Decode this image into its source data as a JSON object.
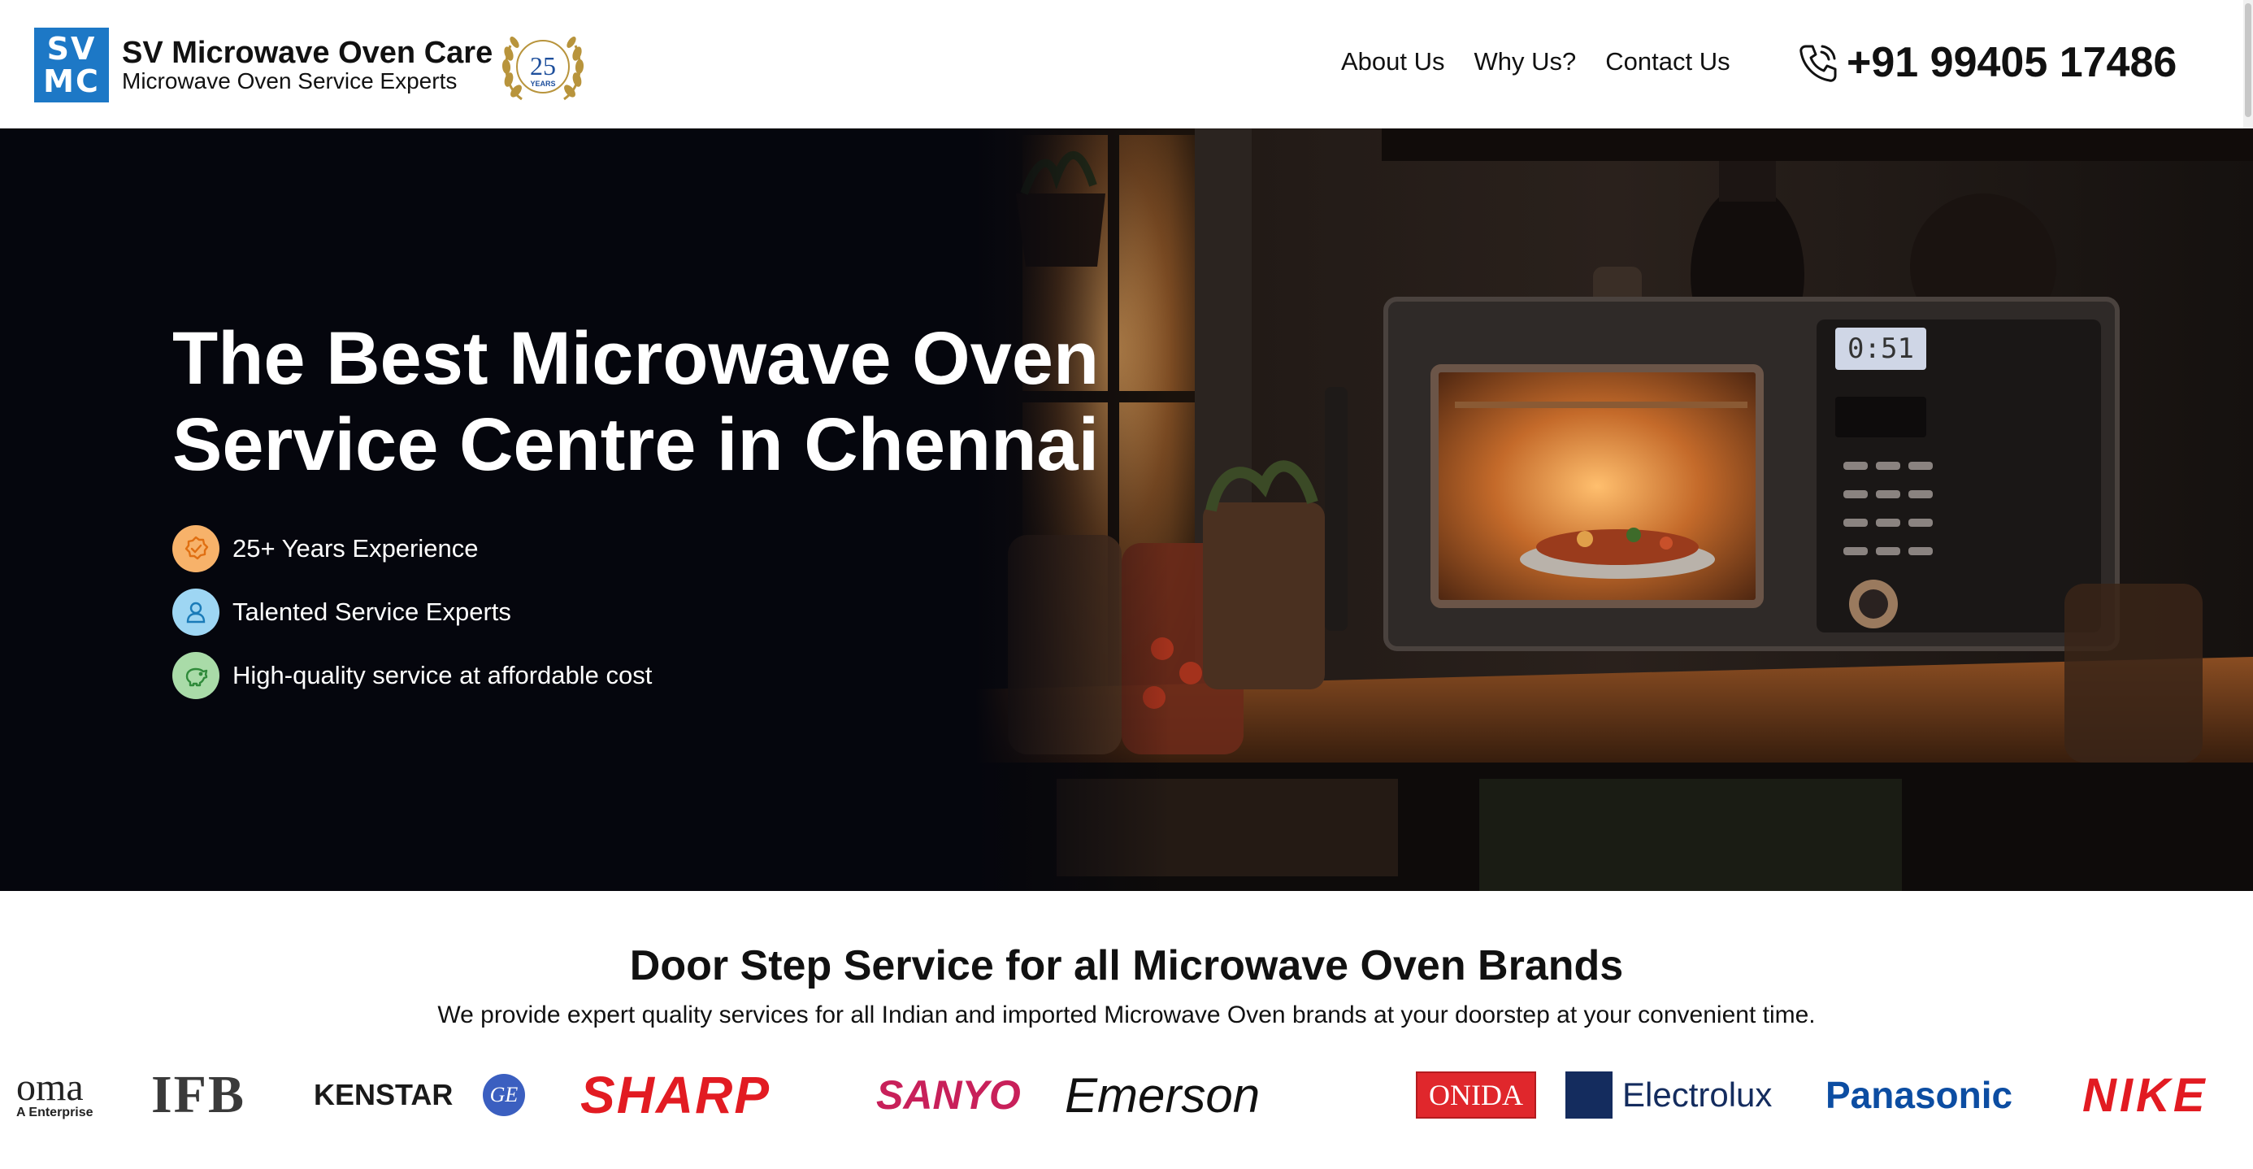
{
  "header": {
    "logo_letters_top": "SV",
    "logo_letters_bottom": "MC",
    "brand_name": "SV Microwave Oven Care",
    "brand_tagline": "Microwave Oven Service Experts",
    "badge_number": "25",
    "badge_text": "YEARS"
  },
  "nav": {
    "items": [
      {
        "label": "About Us"
      },
      {
        "label": "Why Us?"
      },
      {
        "label": "Contact Us"
      }
    ]
  },
  "phone": {
    "icon": "phone-call-icon",
    "number": "+91 99405 17486"
  },
  "hero": {
    "title_line1": "The Best Microwave Oven",
    "title_line2": "Service Centre in Chennai",
    "features": [
      {
        "label": "25+ Years Experience",
        "icon": "badge-check-icon",
        "color": "#f7b26a"
      },
      {
        "label": "Talented Service Experts",
        "icon": "user-icon",
        "color": "#9ed6f3"
      },
      {
        "label": "High-quality service at affordable cost",
        "icon": "piggy-bank-icon",
        "color": "#a9dba8"
      }
    ],
    "oven_display": "0:51"
  },
  "brands": {
    "heading": "Door Step Service for all Microwave Oven Brands",
    "subheading": "We provide expert quality services for all Indian and imported Microwave Oven brands at your doorstep at your convenient time.",
    "logos": [
      {
        "name": "oma",
        "sub": "A Enterprise"
      },
      {
        "name": "IFB"
      },
      {
        "name": "KENSTAR"
      },
      {
        "name": "GE"
      },
      {
        "name": "SHARP"
      },
      {
        "name": "SANYO"
      },
      {
        "name": "Emerson"
      },
      {
        "name": "ONIDA"
      },
      {
        "name": "Electrolux"
      },
      {
        "name": "Panasonic"
      },
      {
        "name": "NIKE"
      }
    ]
  },
  "colors": {
    "logo_blue": "#1d78c6",
    "badge_gold": "#b8943c",
    "badge_blue": "#1e4f9c",
    "hero_bg": "#05060d"
  }
}
